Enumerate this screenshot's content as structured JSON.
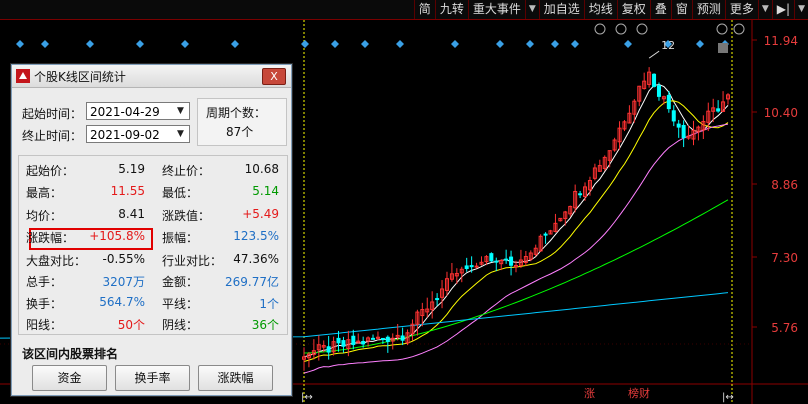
{
  "toolbar": {
    "items": [
      "简",
      "九转",
      "重大事件",
      "加自选",
      "均线",
      "复权",
      "叠",
      "窗",
      "预测",
      "更多"
    ]
  },
  "chart": {
    "y_ticks": [
      "11.94",
      "10.40",
      "8.86",
      "7.30",
      "5.76"
    ],
    "peak_label": "12",
    "bottom_labels": [
      "涨",
      "榜财"
    ],
    "colors": {
      "up": "#ff3232",
      "down": "#00ffff",
      "ma5": "#ffffff",
      "ma10": "#ffff00",
      "ma20": "#ff80ff",
      "ma60": "#00ff00",
      "ma120": "#00c8ff"
    }
  },
  "dialog": {
    "title": "个股K线区间统计",
    "close_label": "X",
    "start_label": "起始时间：",
    "start_value": "2021-04-29",
    "end_label": "终止时间：",
    "end_value": "2021-09-02",
    "period_label": "周期个数：",
    "period_value": "87个",
    "stats_left": [
      {
        "label": "起始价：",
        "value": "5.19",
        "color": "blk"
      },
      {
        "label": "最高：",
        "value": "11.55",
        "color": "red"
      },
      {
        "label": "均价：",
        "value": "8.41",
        "color": "blk"
      },
      {
        "label": "涨跌幅：",
        "value": "+105.8%",
        "color": "red"
      },
      {
        "label": "大盘对比：",
        "value": "-0.55%",
        "color": "blk"
      },
      {
        "label": "总手：",
        "value": "3207万",
        "color": "blu"
      },
      {
        "label": "换手：",
        "value": "564.7%",
        "color": "blu"
      },
      {
        "label": "阳线：",
        "value": "50个",
        "color": "red"
      }
    ],
    "stats_right": [
      {
        "label": "终止价：",
        "value": "10.68",
        "color": "blk"
      },
      {
        "label": "最低：",
        "value": "5.14",
        "color": "grn"
      },
      {
        "label": "涨跌值：",
        "value": "+5.49",
        "color": "red"
      },
      {
        "label": "振幅：",
        "value": "123.5%",
        "color": "blu"
      },
      {
        "label": "行业对比：",
        "value": "47.36%",
        "color": "blk"
      },
      {
        "label": "金额：",
        "value": "269.77亿",
        "color": "blu"
      },
      {
        "label": "平线：",
        "value": "1个",
        "color": "blu"
      },
      {
        "label": "阴线：",
        "value": "36个",
        "color": "grn"
      }
    ],
    "rank_title": "该区间内股票排名",
    "buttons": [
      "资金",
      "换手率",
      "涨跌幅"
    ]
  }
}
